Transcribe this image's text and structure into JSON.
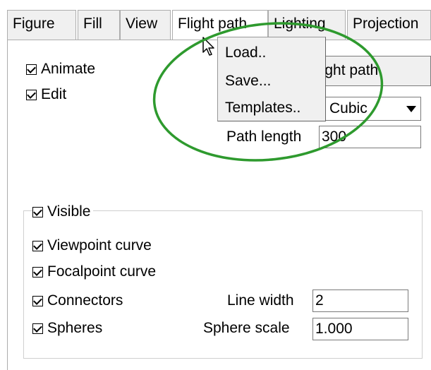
{
  "tabs": [
    {
      "label": "Figure"
    },
    {
      "label": "Fill"
    },
    {
      "label": "View"
    },
    {
      "label": "Flight path"
    },
    {
      "label": "Lighting"
    },
    {
      "label": "Projection"
    }
  ],
  "options": {
    "animate": "Animate",
    "edit": "Edit"
  },
  "flight_path_button": "light path",
  "curve_select": {
    "value": "Cubic"
  },
  "path_length": {
    "label": "Path length",
    "value": "300"
  },
  "menu": {
    "items": [
      "Load..",
      "Save...",
      "Templates.."
    ]
  },
  "group": {
    "visible": "Visible",
    "viewpoint_curve": "Viewpoint curve",
    "focalpoint_curve": "Focalpoint curve",
    "connectors": "Connectors",
    "spheres": "Spheres",
    "line_width": {
      "label": "Line width",
      "value": "2"
    },
    "sphere_scale": {
      "label": "Sphere scale",
      "value": "1.000"
    }
  },
  "colors": {
    "annotation": "#2e9a2e",
    "tab_bg": "#f0f0f0"
  }
}
